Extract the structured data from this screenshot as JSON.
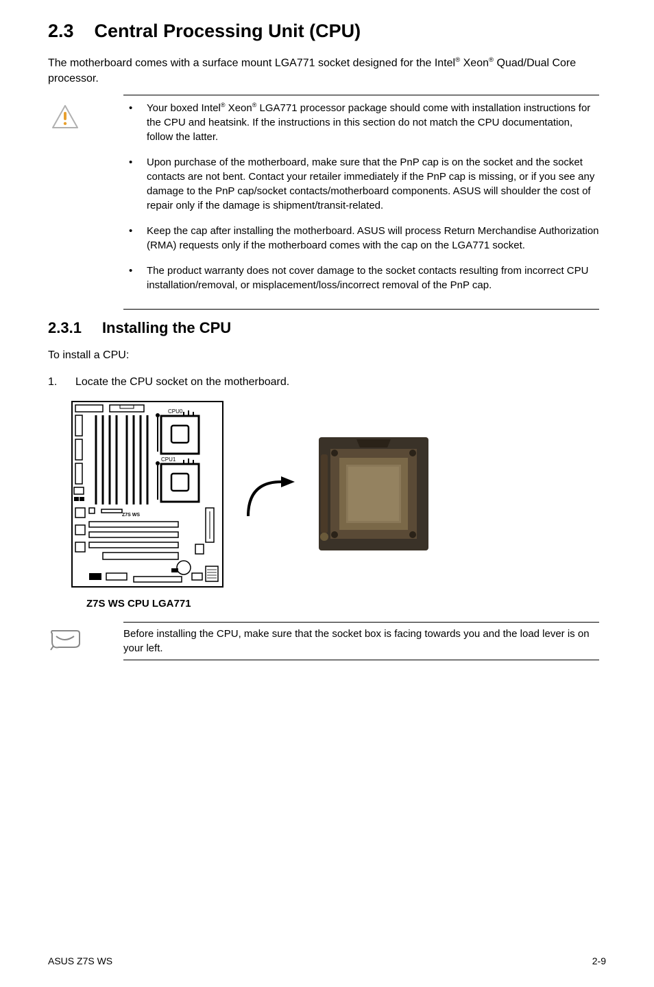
{
  "section": {
    "number": "2.3",
    "title": "Central Processing Unit (CPU)"
  },
  "intro": "The motherboard comes with a surface mount LGA771 socket designed for the Intel® Xeon® Quad/Dual Core processor.",
  "warnings": {
    "b1": "Your boxed Intel® Xeon® LGA771 processor package should come with installation instructions for the CPU and heatsink. If the instructions in this section do not match the CPU documentation, follow the latter.",
    "b2": "Upon purchase of the motherboard, make sure that the PnP cap is on the socket and the socket contacts are not bent. Contact your retailer immediately if the PnP cap is missing, or if you see any damage to the PnP cap/socket contacts/motherboard components. ASUS will shoulder the cost of repair only if the damage is shipment/transit-related.",
    "b3": "Keep the cap after installing the motherboard. ASUS will process Return Merchandise Authorization (RMA) requests only if the motherboard comes with the cap on the LGA771 socket.",
    "b4": "The product warranty does not cover damage to the socket contacts resulting from incorrect CPU installation/removal, or misplacement/loss/incorrect removal of the PnP cap."
  },
  "subsection": {
    "number": "2.3.1",
    "title": "Installing the CPU"
  },
  "install_intro": "To install a CPU:",
  "step1": {
    "num": "1.",
    "text": "Locate the CPU socket on the motherboard."
  },
  "figure": {
    "cpu0": "CPU0",
    "cpu1": "CPU1",
    "board": "Z7S WS",
    "caption": "Z7S WS CPU LGA771"
  },
  "note": "Before installing the CPU, make sure that the socket box is facing towards you and the load lever is on your left.",
  "footer": {
    "left": "ASUS Z7S WS",
    "right": "2-9"
  }
}
